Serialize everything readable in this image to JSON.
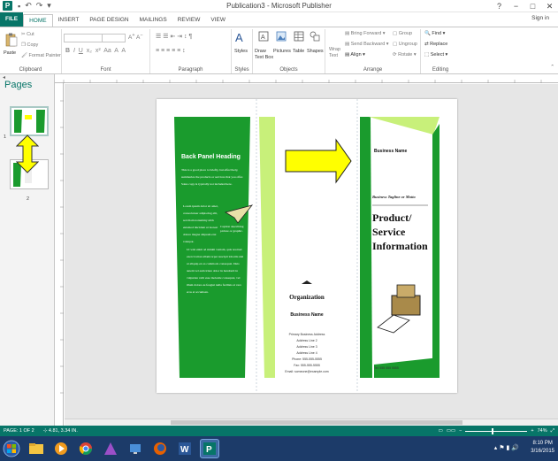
{
  "window": {
    "title": "Publication3 - Microsoft Publisher",
    "controls": [
      "?",
      "−",
      "□",
      "✕"
    ]
  },
  "tabs": [
    "FILE",
    "HOME",
    "INSERT",
    "PAGE DESIGN",
    "MAILINGS",
    "REVIEW",
    "VIEW"
  ],
  "signin": "Sign in",
  "ribbon": {
    "clipboard": {
      "paste": "Paste",
      "cut": "Cut",
      "copy": "Copy",
      "format_painter": "Format Painter",
      "label": "Clipboard"
    },
    "font": {
      "label": "Font"
    },
    "paragraph": {
      "label": "Paragraph"
    },
    "styles": {
      "styles": "Styles",
      "label": "Styles"
    },
    "objects": {
      "draw_text_box": "Draw Text Box",
      "pictures": "Pictures",
      "table": "Table",
      "shapes": "Shapes",
      "label": "Objects"
    },
    "arrange": {
      "wrap_text": "Wrap Text",
      "bring_forward": "Bring Forward",
      "send_backward": "Send Backward",
      "align": "Align",
      "group": "Group",
      "ungroup": "Ungroup",
      "rotate": "Rotate",
      "label": "Arrange"
    },
    "editing": {
      "find": "Find",
      "replace": "Replace",
      "select": "Select",
      "label": "Editing"
    }
  },
  "pages_pane": {
    "title": "Pages",
    "page_numbers": [
      "1",
      "2"
    ]
  },
  "brochure": {
    "back_heading": "Back Panel Heading",
    "back_intro": "This is a good place to briefly, but effectively, summarize the products or services that you offer. Sales copy is typically not included here.",
    "back_body_left": "Lorem ipsum dolor sit amet, consectetuer adipiscing elit, sed diam nonummy nibh euismod tincidunt ut laoreet dolore magna aliquam erat volutpat.",
    "back_body_full": "Ut wisi enim ad minim veniam, quis nostrud exerci tation ullamcorper suscipit lobortis nisl ut aliquip ex ea commodo consequat. Duis autem vel eum iriure dolor in hendrerit in vulputate velit esse molestie consequat, vel illum dolore eu feugiat nulla facilisis at vero eros et accumsan.",
    "caption": "Caption describing picture or graphic.",
    "organization": "Organization",
    "business_name": "Business Name",
    "address": [
      "Primary Business Address",
      "Address Line 2",
      "Address Line 3",
      "Address Line 4"
    ],
    "phone": "Phone: 555-555-5555",
    "fax": "Fax: 555-555-5555",
    "email": "Email: someone@example.com",
    "cover_business_name": "Business Name",
    "tagline": "Business Tagline or Motto",
    "product_title": [
      "Product/",
      "Service",
      "Information"
    ],
    "cover_phone": "Tel: 555 555 5555"
  },
  "status": {
    "page": "PAGE: 1 OF 2",
    "position": "4.81, 3.34 IN.",
    "zoom": "74%"
  },
  "taskbar": {
    "time": "8:10 PM",
    "date": "3/16/2015"
  },
  "colors": {
    "accent": "#077568",
    "green": "#1a9b2d",
    "lime": "#c8f07a",
    "arrow": "#ffff00"
  }
}
